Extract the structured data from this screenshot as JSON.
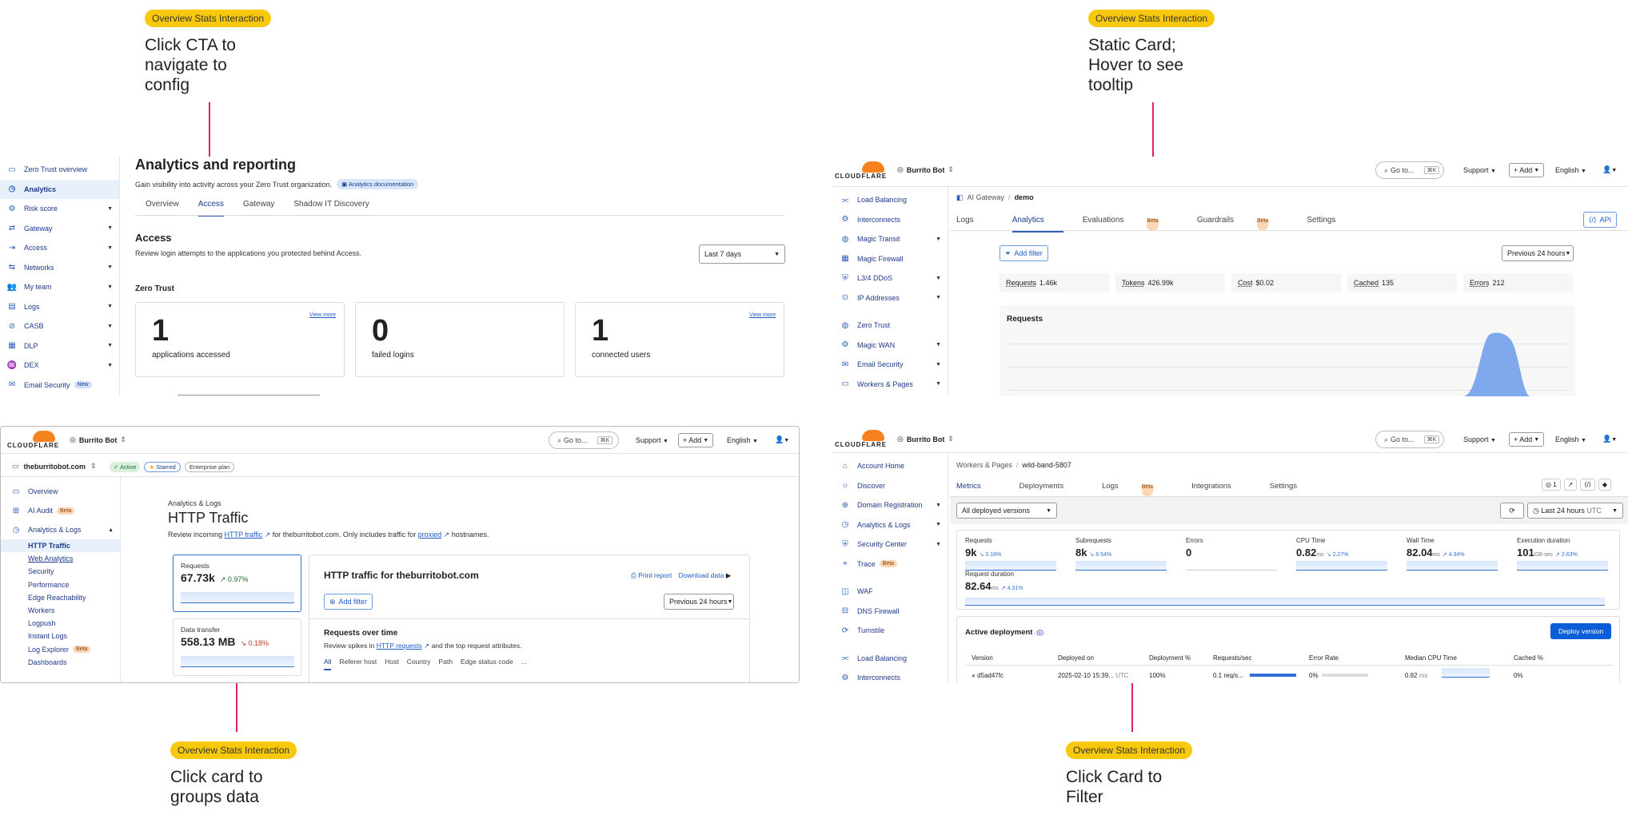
{
  "annotations": [
    {
      "badge": "Overview Stats Interaction",
      "note": "Click CTA to navigate to config"
    },
    {
      "badge": "Overview Stats Interaction",
      "note": "Static Card; Hover to see tooltip"
    },
    {
      "badge": "Overview Stats Interaction",
      "note": "Click card to groups data"
    },
    {
      "badge": "Overview Stats Interaction",
      "note": "Click Card to Filter"
    }
  ],
  "zt": {
    "sidebar": [
      {
        "label": "Zero Trust overview",
        "icon": "▭"
      },
      {
        "label": "Analytics",
        "icon": "◷"
      },
      {
        "label": "Risk score",
        "icon": "⚙"
      },
      {
        "label": "Gateway",
        "icon": "⇄"
      },
      {
        "label": "Access",
        "icon": "⇥"
      },
      {
        "label": "Networks",
        "icon": "⇆"
      },
      {
        "label": "My team",
        "icon": "👥"
      },
      {
        "label": "Logs",
        "icon": "▤"
      },
      {
        "label": "CASB",
        "icon": "⊘"
      },
      {
        "label": "DLP",
        "icon": "▦"
      },
      {
        "label": "DEX",
        "icon": "♒"
      },
      {
        "label": "Email Security",
        "icon": "✉",
        "tag": "New"
      }
    ],
    "title": "Analytics and reporting",
    "subtitle": "Gain visibility into activity across your Zero Trust organization.",
    "doc_link": "Analytics documentation",
    "tabs": [
      "Overview",
      "Access",
      "Gateway",
      "Shadow IT Discovery"
    ],
    "section": "Access",
    "section_desc": "Review login attempts to the applications you protected behind Access.",
    "range": "Last 7 days",
    "group": "Zero Trust",
    "cards": [
      {
        "value": "1",
        "label": "applications accessed",
        "link": "View more"
      },
      {
        "value": "0",
        "label": "failed logins",
        "link": ""
      },
      {
        "value": "1",
        "label": "connected users",
        "link": "View more"
      }
    ]
  },
  "brand": "CLOUDFLARE",
  "account": "Burrito Bot",
  "topnav": {
    "goto": "Go to...",
    "kbd": "⌘K",
    "support": "Support",
    "add": "+ Add",
    "lang": "English"
  },
  "ai": {
    "sidebar": [
      {
        "label": "Load Balancing",
        "chev": false
      },
      {
        "label": "Interconnects",
        "chev": false
      },
      {
        "label": "Magic Transit",
        "chev": true
      },
      {
        "label": "Magic Firewall",
        "chev": false
      },
      {
        "label": "L3/4 DDoS",
        "chev": true
      },
      {
        "label": "IP Addresses",
        "chev": true
      },
      {
        "label": "Zero Trust",
        "chev": false
      },
      {
        "label": "Magic WAN",
        "chev": true
      },
      {
        "label": "Email Security",
        "chev": true
      },
      {
        "label": "Workers & Pages",
        "chev": true
      }
    ],
    "crumb1": "AI Gateway",
    "crumb2": "demo",
    "tabs": [
      {
        "label": "Logs"
      },
      {
        "label": "Analytics"
      },
      {
        "label": "Evaluations",
        "tag": "Beta"
      },
      {
        "label": "Guardrails",
        "tag": "Beta"
      },
      {
        "label": "Settings"
      }
    ],
    "api": "API",
    "filter": "Add filter",
    "range": "Previous 24 hours",
    "stats": [
      {
        "k": "Requests",
        "v": "1.46k"
      },
      {
        "k": "Tokens",
        "v": "426.99k"
      },
      {
        "k": "Cost",
        "v": "$0.02"
      },
      {
        "k": "Cached",
        "v": "135"
      },
      {
        "k": "Errors",
        "v": "212"
      }
    ],
    "chart_title": "Requests"
  },
  "ht": {
    "zone": "theburritobot.com",
    "active": "Active",
    "starred": "Starred",
    "plan": "Enterprise plan",
    "sidebar": [
      {
        "label": "Overview",
        "level": 0
      },
      {
        "label": "AI Audit",
        "level": 0,
        "tag": "Beta"
      },
      {
        "label": "Analytics & Logs",
        "level": 0
      },
      {
        "label": "HTTP Traffic",
        "level": 1
      },
      {
        "label": "Web Analytics",
        "level": 1
      },
      {
        "label": "Security",
        "level": 1
      },
      {
        "label": "Performance",
        "level": 1
      },
      {
        "label": "Edge Reachability",
        "level": 1
      },
      {
        "label": "Workers",
        "level": 1
      },
      {
        "label": "Logpush",
        "level": 1
      },
      {
        "label": "Instant Logs",
        "level": 1
      },
      {
        "label": "Log Explorer",
        "level": 1,
        "tag": "Beta"
      },
      {
        "label": "Dashboards",
        "level": 1
      }
    ],
    "crumb": "Analytics & Logs",
    "title": "HTTP Traffic",
    "desc_a": "Review incoming",
    "desc_link1": "HTTP traffic",
    "desc_b": "for theburritobot.com. Only includes traffic for",
    "desc_link2": "proxied",
    "desc_c": "hostnames.",
    "cards": [
      {
        "label": "Requests",
        "value": "67.73k",
        "delta": "↗ 0.97%"
      },
      {
        "label": "Data transfer",
        "value": "558.13 MB",
        "delta": "↘ 0.18%"
      }
    ],
    "main_title": "HTTP traffic for theburritobot.com",
    "print": "Print report",
    "download": "Download data",
    "filter": "Add filter",
    "range": "Previous 24 hours",
    "rot_title": "Requests over time",
    "rot_a": "Review spikes in",
    "rot_link": "HTTP requests",
    "rot_b": "and the top request attributes.",
    "subtabs": [
      "All",
      "Referer host",
      "Host",
      "Country",
      "Path",
      "Edge status code",
      "..."
    ]
  },
  "wp": {
    "sidebar": [
      {
        "label": "Account Home",
        "chev": false
      },
      {
        "label": "Discover",
        "chev": false
      },
      {
        "label": "Domain Registration",
        "chev": true
      },
      {
        "label": "Analytics & Logs",
        "chev": true
      },
      {
        "label": "Security Center",
        "chev": true
      },
      {
        "label": "Trace",
        "chev": false,
        "tag": "Beta"
      },
      {
        "label": "WAF",
        "chev": false
      },
      {
        "label": "DNS Firewall",
        "chev": false
      },
      {
        "label": "Turnstile",
        "chev": false
      },
      {
        "label": "Load Balancing",
        "chev": false
      },
      {
        "label": "Interconnects",
        "chev": false
      }
    ],
    "crumb1": "Workers & Pages",
    "crumb2": "wild-band-5807",
    "tabs": [
      {
        "label": "Metrics"
      },
      {
        "label": "Deployments"
      },
      {
        "label": "Logs",
        "tag": "Beta"
      },
      {
        "label": "Integrations"
      },
      {
        "label": "Settings"
      }
    ],
    "versions": "All deployed versions",
    "range": "Last 24 hours",
    "range_tz": "UTC",
    "count": "1",
    "metrics": [
      {
        "k": "Requests",
        "v": "9k",
        "u": "",
        "d": "↘ 3.18%"
      },
      {
        "k": "Subrequests",
        "v": "8k",
        "u": "",
        "d": "↘ 8.54%"
      },
      {
        "k": "Errors",
        "v": "0",
        "u": "",
        "d": ""
      },
      {
        "k": "CPU Time",
        "v": "0.82",
        "u": "ms",
        "d": "↘ 2.27%"
      },
      {
        "k": "Wall Time",
        "v": "82.04",
        "u": "ms",
        "d": "↗ 4.34%"
      },
      {
        "k": "Execution duration",
        "v": "101",
        "u": "GB-sec",
        "d": "↗ 2.63%"
      }
    ],
    "reqdur": {
      "k": "Request duration",
      "v": "82.64",
      "u": "ms",
      "d": "↗ 4.31%"
    },
    "active": "Active deployment",
    "deploy_btn": "Deploy version",
    "cols": [
      "Version",
      "Deployed on",
      "Deployment %",
      "Requests/sec",
      "Error Rate",
      "Median CPU Time",
      "Cached %"
    ],
    "row": {
      "version": "d5ad47fc",
      "deployed": "2025-02-10 15:39...",
      "tz": "UTC",
      "pct": "100%",
      "rps": "0.1 req/s...",
      "err": "0%",
      "cpu": "0.82",
      "cpu_u": "ms",
      "cached": "0%"
    }
  }
}
